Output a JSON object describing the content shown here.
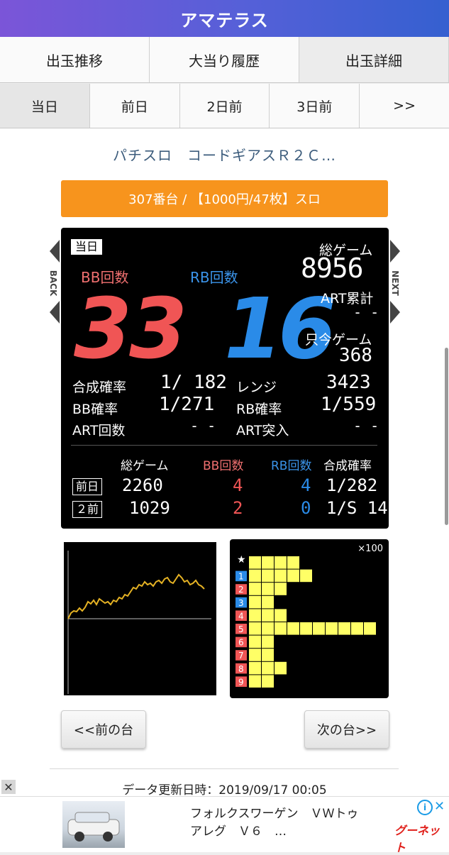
{
  "header": {
    "title": "アマテラス"
  },
  "tabs_main": [
    {
      "label": "出玉推移",
      "active": false
    },
    {
      "label": "大当り履歴",
      "active": false
    },
    {
      "label": "出玉詳細",
      "active": true
    }
  ],
  "tabs_day": [
    {
      "label": "当日",
      "active": true
    },
    {
      "label": "前日",
      "active": false
    },
    {
      "label": "2日前",
      "active": false
    },
    {
      "label": "3日前",
      "active": false
    },
    {
      "label": ">>",
      "active": false
    }
  ],
  "machine_name": "パチスロ　コードギアスＲ２Ｃ…",
  "machine_info": "307番台 / 【1000円/47枚】スロ",
  "panel": {
    "today_label": "当日",
    "back_label": "BACK",
    "next_label": "NEXT",
    "bb_label": "BB回数",
    "rb_label": "RB回数",
    "bb_count": "33",
    "rb_count": "16",
    "total_game_label": "総ゲーム",
    "total_game": "8956",
    "art_total_label": "ART累計",
    "art_total": "- -",
    "current_game_label": "只今ゲーム",
    "current_game": "368",
    "stats": [
      {
        "label": "合成確率",
        "value": "1/ 182",
        "label2": "レンジ",
        "value2": "3423"
      },
      {
        "label": "BB確率",
        "value": "1/271",
        "label2": "RB確率",
        "value2": "1/559"
      },
      {
        "label": "ART回数",
        "value": "- -",
        "label2": "ART突入",
        "value2": "- -"
      }
    ],
    "history_headers": {
      "games": "総ゲーム",
      "bb": "BB回数",
      "rb": "RB回数",
      "prob": "合成確率"
    },
    "history": [
      {
        "day": "前日",
        "games": "2260",
        "bb": "4",
        "rb": "4",
        "prob": "1/282"
      },
      {
        "day": "２前",
        "games": "1029",
        "bb": "2",
        "rb": "0",
        "prob": "1/S 14"
      }
    ]
  },
  "histogram": {
    "unit_label": "×100",
    "star_label": "★",
    "rows": [
      {
        "label": "1",
        "value": 5,
        "color": "#2a8be8"
      },
      {
        "label": "2",
        "value": 3,
        "color": "#f05555"
      },
      {
        "label": "3",
        "value": 2,
        "color": "#2a8be8"
      },
      {
        "label": "4",
        "value": 3,
        "color": "#f05555"
      },
      {
        "label": "5",
        "value": 10,
        "color": "#f05555"
      },
      {
        "label": "6",
        "value": 2,
        "color": "#f05555"
      },
      {
        "label": "7",
        "value": 2,
        "color": "#f05555"
      },
      {
        "label": "8",
        "value": 3,
        "color": "#f05555"
      },
      {
        "label": "9",
        "value": 2,
        "color": "#f05555"
      }
    ],
    "star_value": 4
  },
  "buttons": {
    "prev": "<<前の台",
    "next": "次の台>>"
  },
  "update_text": "データ更新日時：2019/09/17 00:05",
  "ad": {
    "text": "フォルクスワーゲン　ＶＷトゥアレグ　Ｖ６　…",
    "logo": "グーネット",
    "info": "i",
    "close": "✕",
    "close_banner": "✕"
  },
  "colors": {
    "accent": "#f7941d",
    "bb": "#f05555",
    "rb": "#2a8be8",
    "bar": "#ffff66"
  }
}
